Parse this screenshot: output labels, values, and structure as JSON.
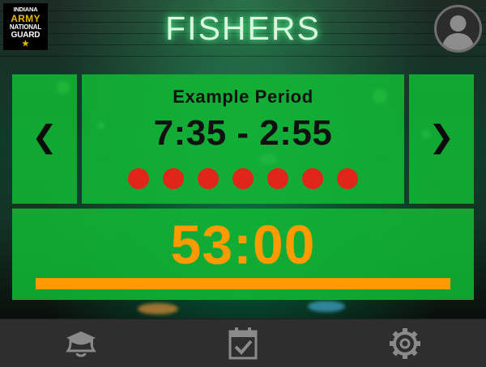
{
  "header": {
    "logo_lines": [
      "INDIANA",
      "ARMY",
      "NATIONAL",
      "GUARD"
    ],
    "logo_star": "★",
    "title": "FISHERS"
  },
  "period": {
    "name": "Example Period",
    "time_range": "7:35 - 2:55",
    "indicator_dot_count": 7
  },
  "navigation": {
    "prev_glyph": "❮",
    "next_glyph": "❯"
  },
  "timer": {
    "countdown": "53:00",
    "progress_fraction": 1.0
  },
  "bottom_tabs": [
    {
      "id": "bell",
      "icon": "bell-icon"
    },
    {
      "id": "calendar",
      "icon": "calendar-check-icon"
    },
    {
      "id": "settings",
      "icon": "gear-icon"
    }
  ],
  "colors": {
    "panel_green": "#12b934",
    "accent_orange": "#ff9a00",
    "dot_red": "#e0251b",
    "title_glow": "#5aff96",
    "bottom_bar": "#2e2e2e",
    "icon_gray": "#8a8a8a"
  }
}
